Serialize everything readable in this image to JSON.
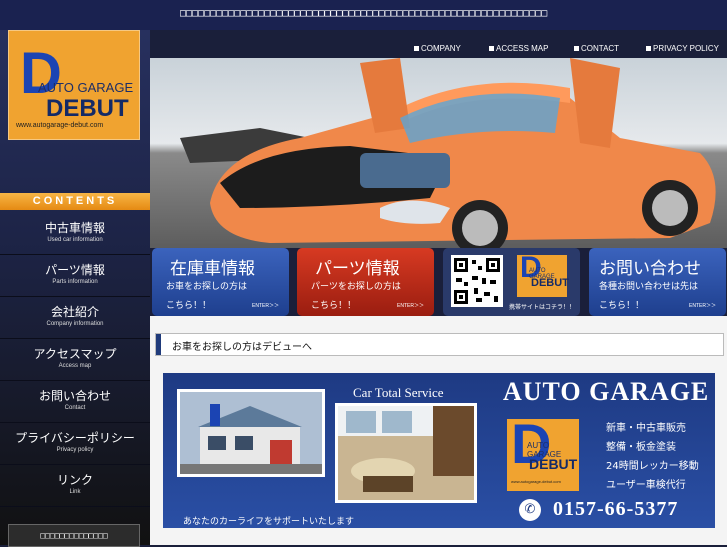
{
  "tagline": "□□□□□□□□□□□□□□□□□□□□□□□□□□□□□□□□□□□□□□□□□□□□□□□□□□□□□□□□□□□□□",
  "logo": {
    "letter": "D",
    "name": "AUTO GARAGE",
    "brand": "DEBUT",
    "url": "www.autogarage-debut.com"
  },
  "header_links": [
    "COMPANY",
    "ACCESS MAP",
    "CONTACT",
    "PRIVACY POLICY"
  ],
  "contents_label": "CONTENTS",
  "nav": [
    {
      "jp": "中古車情報",
      "en": "Used car information"
    },
    {
      "jp": "パーツ情報",
      "en": "Parts information"
    },
    {
      "jp": "会社紹介",
      "en": "Company information"
    },
    {
      "jp": "アクセスマップ",
      "en": "Access map"
    },
    {
      "jp": "お問い合わせ",
      "en": "Contact"
    },
    {
      "jp": "プライバシーポリシー",
      "en": "Privacy policy"
    },
    {
      "jp": "リンク",
      "en": "Link"
    }
  ],
  "left_box": "□□□□□□□□□□□□□□",
  "banners": [
    {
      "title": "在庫車情報",
      "line1": "お車をお探しの方は",
      "line2": "こちら！！",
      "enter": "ENTER＞＞"
    },
    {
      "title": "パーツ情報",
      "line1": "パーツをお探しの方は",
      "line2": "こちら！！",
      "enter": "ENTER＞＞"
    },
    {
      "mobile_label": "携帯サイトはコチラ！！",
      "logo_ag": "AUTO GARAGE",
      "logo_debut": "DEBUT"
    },
    {
      "title": "お問い合わせ",
      "line1": "各種お問い合わせは先は",
      "line2": "こちら！！",
      "enter": "ENTER＞＞"
    }
  ],
  "section_title": "お車をお探しの方はデビューへ",
  "big_banner": {
    "service": "Car Total Service",
    "brand": "AUTO GARAGE",
    "logo_ag": "AUTO GARAGE",
    "logo_debut": "DEBUT",
    "logo_url": "www.autogarage-debut.com",
    "services": [
      "新車・中古車販売",
      "整備・板金塗装",
      "24時間レッカー移動",
      "ユーザー車検代行"
    ],
    "phone": "0157-66-5377",
    "tagline": "あなたのカーライフをサポートいたします"
  },
  "colors": {
    "nav_bg": "#1d2447",
    "accent_orange": "#f0a330",
    "banner_blue": "#2a52a8",
    "banner_red": "#c62c1c"
  }
}
